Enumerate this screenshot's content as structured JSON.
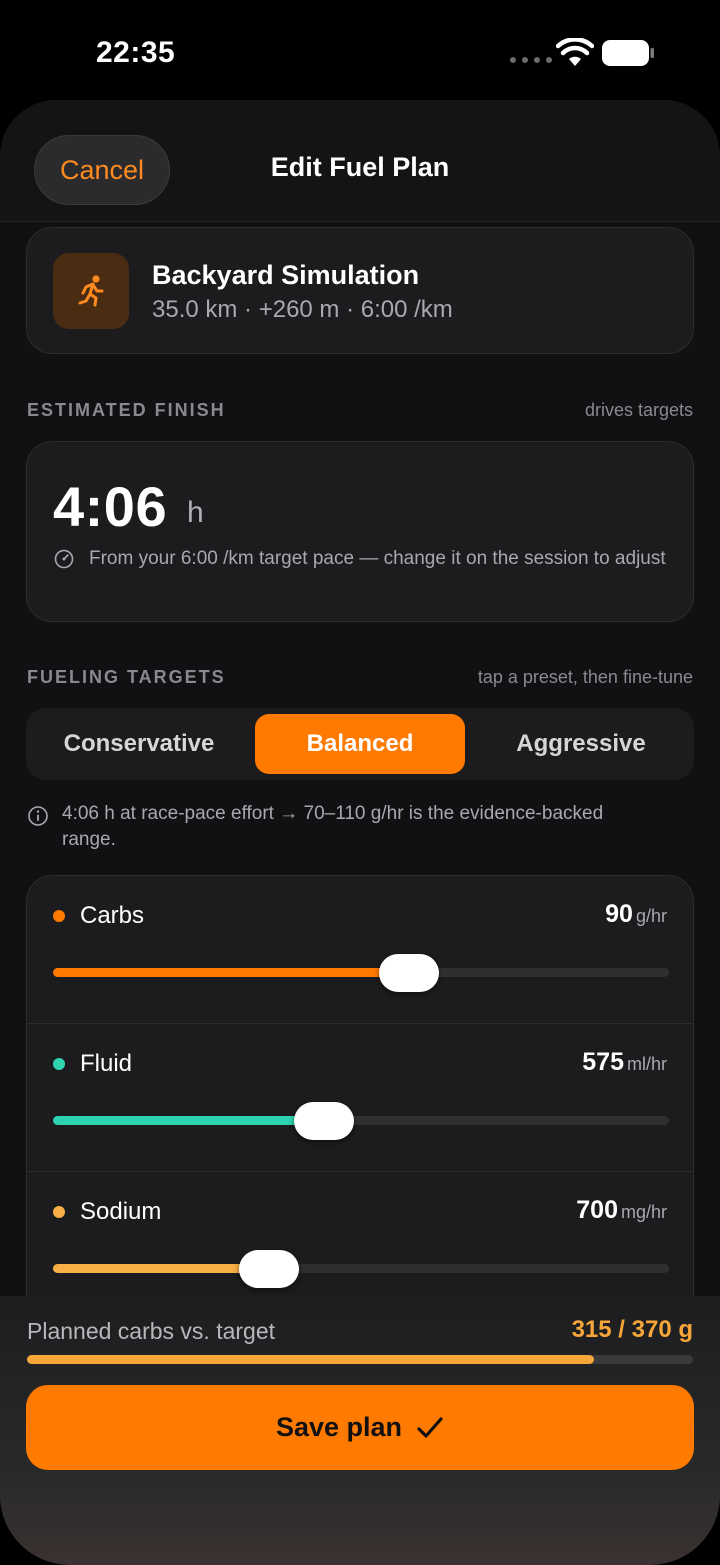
{
  "status_bar": {
    "time": "22:35"
  },
  "header": {
    "cancel_label": "Cancel",
    "title": "Edit Fuel Plan"
  },
  "session": {
    "icon": "runner-icon",
    "title": "Backyard Simulation",
    "meta": "35.0 km · +260 m · 6:00 /km"
  },
  "estimated_finish": {
    "label": "ESTIMATED FINISH",
    "hint": "drives targets",
    "value": "4:06",
    "unit": "h",
    "note": "From your 6:00 /km target pace — change it on the session to adjust"
  },
  "fueling_targets": {
    "label": "FUELING TARGETS",
    "hint": "tap a preset, then fine-tune",
    "presets": [
      {
        "label": "Conservative",
        "active": false
      },
      {
        "label": "Balanced",
        "active": true
      },
      {
        "label": "Aggressive",
        "active": false
      }
    ],
    "info": "4:06 h at race-pace effort → 70–110 g/hr is the evidence-backed range.",
    "rows": [
      {
        "label": "Carbs",
        "value": "90",
        "unit": "g/hr",
        "level": 0.578,
        "color": "#ff7a00"
      },
      {
        "label": "Fluid",
        "value": "575",
        "unit": "ml/hr",
        "level": 0.44,
        "color": "#2ed3b0"
      },
      {
        "label": "Sodium",
        "value": "700",
        "unit": "mg/hr",
        "level": 0.35,
        "color": "#f7b045"
      }
    ]
  },
  "footer": {
    "label": "Planned carbs vs. target",
    "value": "315 / 370 g",
    "progress": 0.851,
    "save_label": "Save plan"
  }
}
